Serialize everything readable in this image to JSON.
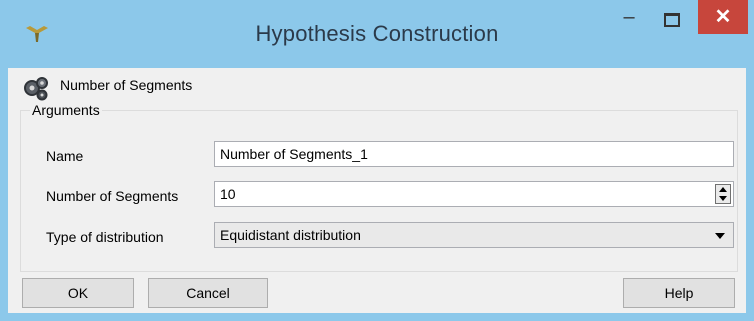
{
  "window": {
    "title": "Hypothesis Construction",
    "close_glyph": "✕",
    "minimize_glyph": "–"
  },
  "hypothesis": {
    "icon": "gear-cluster-icon",
    "label": "Number of Segments"
  },
  "arguments": {
    "group_title": "Arguments",
    "name_label": "Name",
    "name_value": "Number of Segments_1",
    "segments_label": "Number of Segments",
    "segments_value": "10",
    "distribution_label": "Type of distribution",
    "distribution_value": "Equidistant distribution"
  },
  "buttons": {
    "ok": "OK",
    "cancel": "Cancel",
    "help": "Help"
  },
  "colors": {
    "titlebar": "#8cc8ea",
    "close": "#c7463c",
    "client": "#f0f0f0"
  }
}
